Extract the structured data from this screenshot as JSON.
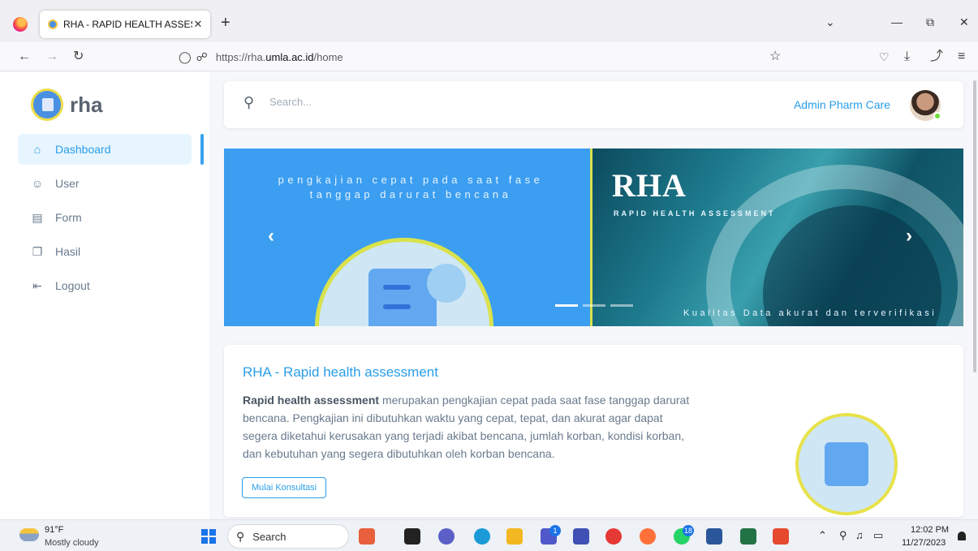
{
  "browser": {
    "tab_title": "RHA - RAPID HEALTH ASSESSM",
    "tab_close": "✕",
    "new_tab": "+",
    "url_prefix": "https://rha.",
    "url_host": "umla.ac.id",
    "url_path": "/home",
    "icons": [
      "back-arrow-icon",
      "forward-arrow-icon",
      "reload-icon",
      "shield-icon",
      "lock-icon",
      "bookmark-star-icon",
      "pocket-icon",
      "download-icon",
      "share-icon",
      "menu-icon"
    ]
  },
  "sidebar": {
    "brand": "rha",
    "items": [
      {
        "label": "Dashboard",
        "icon": "home-icon",
        "active": true
      },
      {
        "label": "User",
        "icon": "user-icon"
      },
      {
        "label": "Form",
        "icon": "form-icon"
      },
      {
        "label": "Hasil",
        "icon": "copy-icon"
      },
      {
        "label": "Logout",
        "icon": "logout-icon"
      }
    ]
  },
  "header": {
    "search_placeholder": "Search...",
    "admin_name": "Admin Pharm Care"
  },
  "carousel": {
    "left_text": "pengkajian cepat pada saat fase tanggap darurat bencana",
    "title": "RHA",
    "subtitle": "RAPID HEALTH ASSESSMENT",
    "tagline": "Kualitas Data akurat dan terverifikasi",
    "prev": "‹",
    "next": "›",
    "indicators": 3,
    "active_indicator": 0
  },
  "card": {
    "title": "RHA - Rapid health assessment",
    "body_bold": "Rapid health assessment",
    "body_rest": " merupakan pengkajian cepat pada saat fase tanggap darurat bencana. Pengkajian ini dibutuhkan waktu yang cepat, tepat, dan akurat agar dapat segera diketahui kerusakan yang terjadi akibat bencana, jumlah korban, kondisi korban, dan kebutuhan yang segera dibutuhkan oleh korban bencana.",
    "button": "Mulai Konsultasi"
  },
  "taskbar": {
    "weather_temp": "91°F",
    "weather_desc": "Mostly cloudy",
    "search_label": "Search",
    "badge_teams": "1",
    "badge_whatsapp": "18",
    "time": "12:02 PM",
    "date": "11/27/2023"
  },
  "colors": {
    "accent": "#2a9ee8",
    "banner_blue": "#3b9ef0",
    "highlight_yellow": "#d9e24c"
  }
}
